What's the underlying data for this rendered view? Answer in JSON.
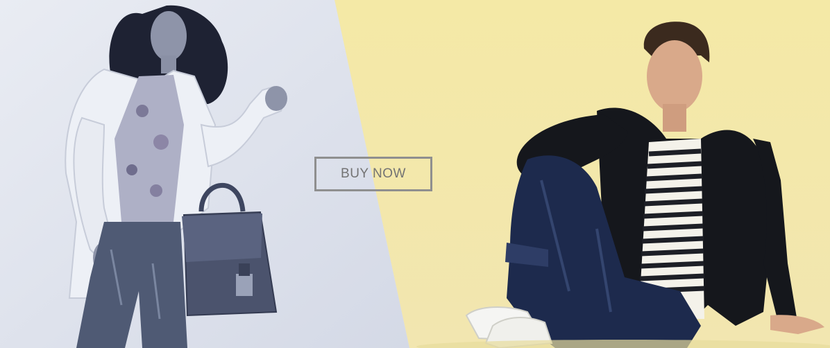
{
  "banner": {
    "cta_label": "BUY NOW",
    "colors": {
      "left_panel": "#dfe3ec",
      "right_panel": "#f4e9a6",
      "button_border": "#8f8f8f",
      "button_text": "#737373"
    },
    "images": {
      "left": "woman-with-handbag-photo",
      "right": "man-sitting-striped-shirt-photo"
    }
  }
}
